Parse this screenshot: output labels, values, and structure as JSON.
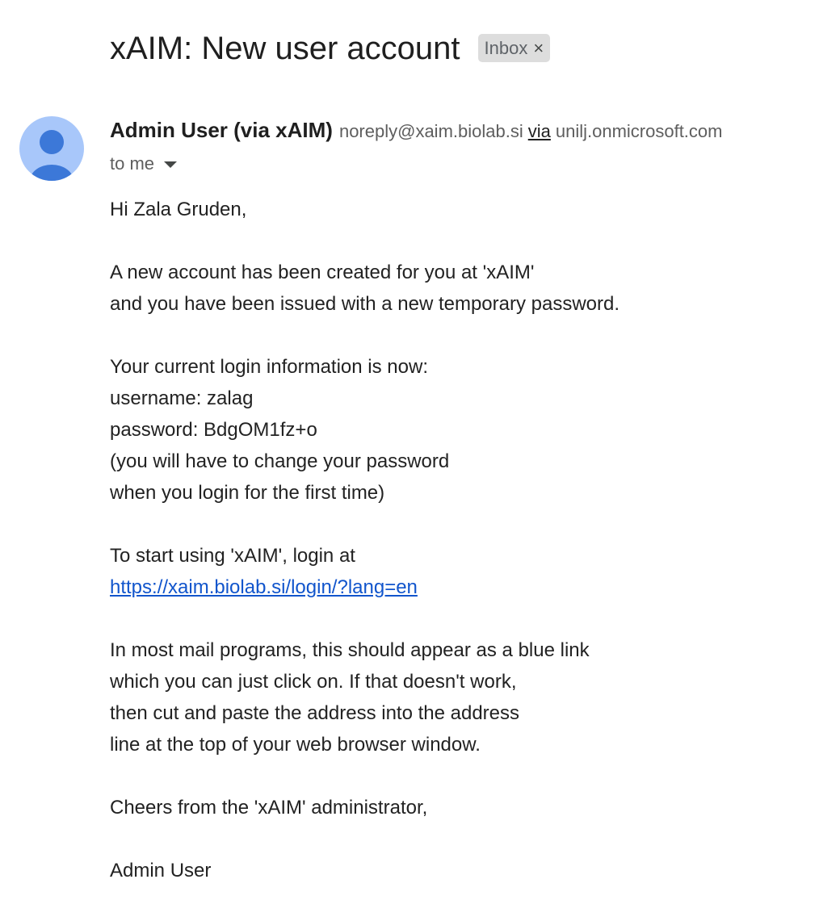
{
  "email": {
    "subject": "xAIM: New user account",
    "label": {
      "text": "Inbox",
      "close_glyph": "×"
    },
    "sender": {
      "name": "Admin User (via xAIM)",
      "email": "noreply@xaim.biolab.si",
      "via_label": "via",
      "via_domain": "unilj.onmicrosoft.com",
      "avatar_icon": "person-avatar-icon"
    },
    "recipient": {
      "text": "to me",
      "icon": "caret-down-icon"
    },
    "body": {
      "greeting": "Hi Zala Gruden,",
      "intro_line1": "A new account has been created for you at 'xAIM'",
      "intro_line2": "and you have been issued with a new temporary password.",
      "login_info_heading": "Your current login information is now:",
      "username_line": "username: zalag",
      "password_line": "password: BdgOM1fz+o",
      "change_note_line1": "(you will have to change your password",
      "change_note_line2": "when you login for the first time)",
      "start_line": "To start using 'xAIM', login at",
      "login_link": "https://xaim.biolab.si/login/?lang=en",
      "help_line1": "In most mail programs, this should appear as a blue link",
      "help_line2": "which you can just click on. If that doesn't work,",
      "help_line3": "then cut and paste the address into the address",
      "help_line4": "line at the top of your web browser window.",
      "signoff": "Cheers from the 'xAIM' administrator,",
      "signature": "Admin User"
    }
  },
  "colors": {
    "link": "#1155cc",
    "avatar_bg": "#a8c7fa",
    "avatar_fg": "#3c78d8",
    "chip_bg": "#dddddd",
    "muted_text": "#5e5e5e"
  }
}
